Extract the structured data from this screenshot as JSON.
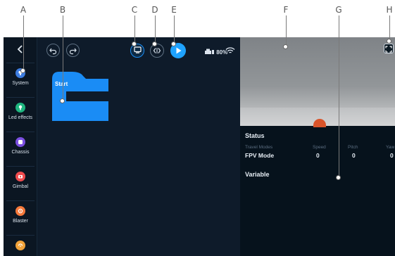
{
  "callouts": [
    "A",
    "B",
    "C",
    "D",
    "E",
    "F",
    "G",
    "H"
  ],
  "sidebar": {
    "items": [
      {
        "label": "System",
        "color": "#3e7de0",
        "icon": "robot-icon"
      },
      {
        "label": "Led effects",
        "color": "#1fb57f",
        "icon": "led-icon"
      },
      {
        "label": "Chassis",
        "color": "#7b4fe0",
        "icon": "chassis-icon"
      },
      {
        "label": "Gimbal",
        "color": "#ef4c4f",
        "icon": "gimbal-icon"
      },
      {
        "label": "Blaster",
        "color": "#f5793b",
        "icon": "blaster-icon"
      },
      {
        "label": "",
        "color": "#f1a33a",
        "icon": "sensor-icon"
      }
    ]
  },
  "toolbar": {
    "undo_icon": "undo-icon",
    "redo_icon": "redo-icon",
    "battery_text": "80%",
    "colors": {
      "run": "#1fa3ff",
      "active": "#1a8ef5"
    }
  },
  "workspace": {
    "start_block_label": "Start",
    "block_color": "#1a8cf5"
  },
  "panel": {
    "status_title": "Status",
    "stat_headers": [
      "Travel Modes",
      "Speed",
      "Pitch",
      "Yaw"
    ],
    "stat_values": [
      "FPV Mode",
      "0",
      "0",
      "0"
    ],
    "variable_title": "Variable"
  }
}
